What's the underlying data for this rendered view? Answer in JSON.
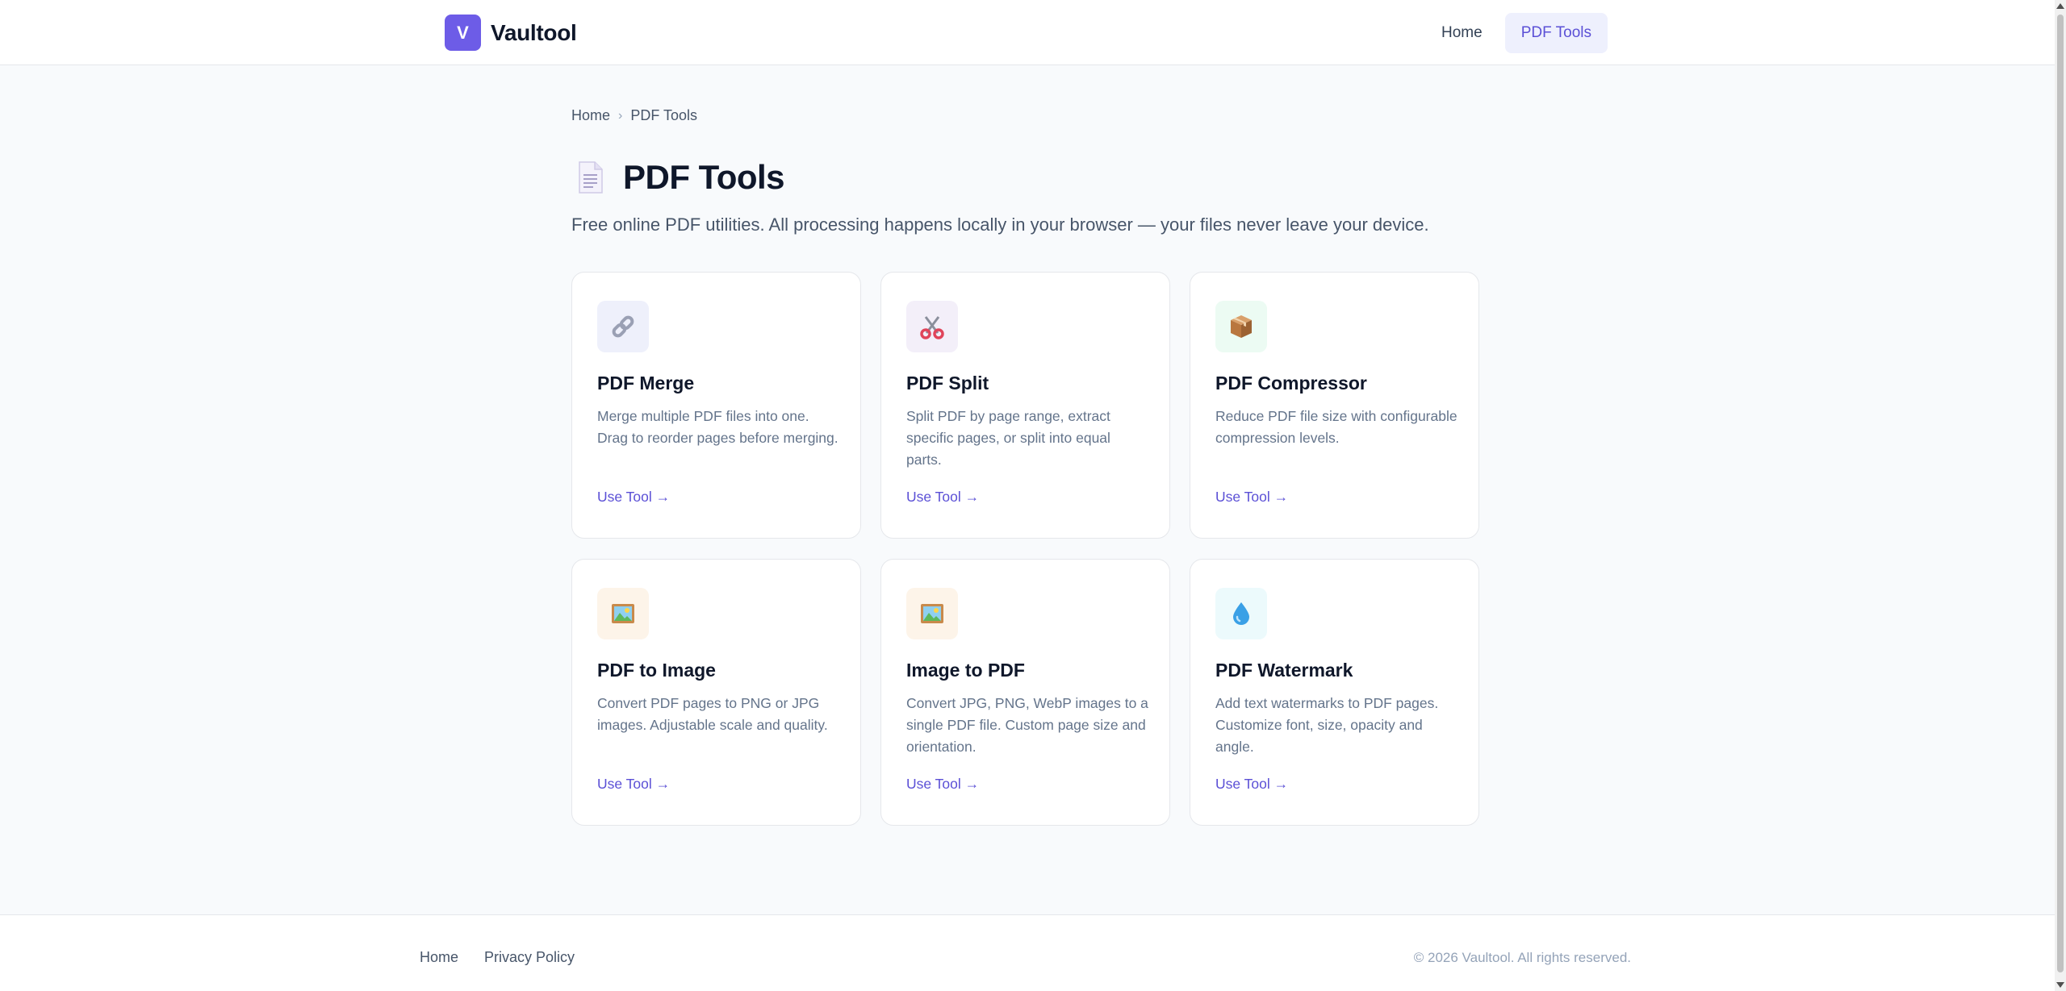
{
  "header": {
    "logo_mark": "V",
    "brand": "Vaultool",
    "nav": [
      {
        "label": "Home",
        "active": false
      },
      {
        "label": "PDF Tools",
        "active": true
      }
    ]
  },
  "breadcrumb": {
    "home": "Home",
    "separator": "›",
    "current": "PDF Tools"
  },
  "page": {
    "title_icon": "document-icon",
    "title": "PDF Tools",
    "description": "Free online PDF utilities. All processing happens locally in your browser — your files never leave your device."
  },
  "tools": [
    {
      "icon": "link-icon",
      "icon_bg": "#eef0fb",
      "title": "PDF Merge",
      "description": "Merge multiple PDF files into one. Drag to reorder pages before merging.",
      "link": "Use Tool →"
    },
    {
      "icon": "scissors-icon",
      "icon_bg": "#f3eff9",
      "title": "PDF Split",
      "description": "Split PDF by page range, extract specific pages, or split into equal parts.",
      "link": "Use Tool →"
    },
    {
      "icon": "package-icon",
      "icon_bg": "#ecfbf3",
      "title": "PDF Compressor",
      "description": "Reduce PDF file size with configurable compression levels.",
      "link": "Use Tool →"
    },
    {
      "icon": "framed-picture-icon",
      "icon_bg": "#fdf4e9",
      "title": "PDF to Image",
      "description": "Convert PDF pages to PNG or JPG images. Adjustable scale and quality.",
      "link": "Use Tool →"
    },
    {
      "icon": "framed-picture-icon",
      "icon_bg": "#fdf4e9",
      "title": "Image to PDF",
      "description": "Convert JPG, PNG, WebP images to a single PDF file. Custom page size and orientation.",
      "link": "Use Tool →"
    },
    {
      "icon": "droplet-icon",
      "icon_bg": "#ecfafc",
      "title": "PDF Watermark",
      "description": "Add text watermarks to PDF pages. Customize font, size, opacity and angle.",
      "link": "Use Tool →"
    }
  ],
  "footer": {
    "links": [
      "Home",
      "Privacy Policy"
    ],
    "copyright": "© 2026 Vaultool. All rights reserved."
  },
  "colors": {
    "brand": "#6d5ce7",
    "accent": "#5b50d6",
    "background": "#f8fafc"
  }
}
